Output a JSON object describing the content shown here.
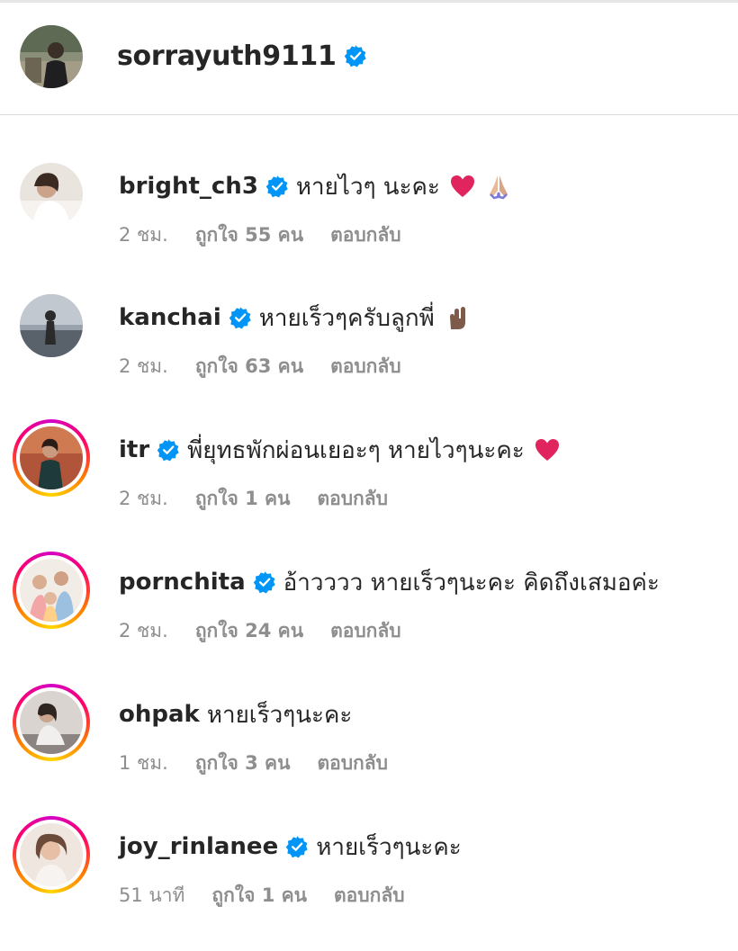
{
  "post_author": {
    "username": "sorrayuth9111",
    "verified": true,
    "avatar": "avatar-man-outdoor"
  },
  "comments": [
    {
      "username": "bright_ch3",
      "verified": true,
      "text": "หายไวๆ นะคะ",
      "emoji": [
        "red-heart-emoji",
        "folded-hands-emoji"
      ],
      "time": "2 ชม.",
      "likes": "ถูกใจ 55 คน",
      "reply": "ตอบกลับ",
      "story_ring": false
    },
    {
      "username": "kanchai",
      "verified": true,
      "text": "หายเร็วๆครับลูกพี่",
      "emoji": [
        "rock-hand-emoji"
      ],
      "time": "2 ชม.",
      "likes": "ถูกใจ 63 คน",
      "reply": "ตอบกลับ",
      "story_ring": false
    },
    {
      "username": "itr",
      "verified": true,
      "text": "พี่ยุทธพักผ่อนเยอะๆ หายไวๆนะคะ",
      "emoji": [
        "red-heart-emoji"
      ],
      "time": "2 ชม.",
      "likes": "ถูกใจ 1 คน",
      "reply": "ตอบกลับ",
      "story_ring": true
    },
    {
      "username": "pornchita",
      "verified": true,
      "text": "อ้าวววว หายเร็วๆนะคะ คิดถึงเสมอค่ะ",
      "emoji": [],
      "time": "2 ชม.",
      "likes": "ถูกใจ 24 คน",
      "reply": "ตอบกลับ",
      "story_ring": true
    },
    {
      "username": "ohpak",
      "verified": false,
      "text": "หายเร็วๆนะคะ",
      "emoji": [],
      "time": "1 ชม.",
      "likes": "ถูกใจ 3 คน",
      "reply": "ตอบกลับ",
      "story_ring": true
    },
    {
      "username": "joy_rinlanee",
      "verified": true,
      "text": "หายเร็วๆนะคะ",
      "emoji": [],
      "time": "51 นาที",
      "likes": "ถูกใจ 1 คน",
      "reply": "ตอบกลับ",
      "story_ring": true
    }
  ],
  "colors": {
    "verified_blue": "#0095f6",
    "meta_gray": "#8e8e8e",
    "text_dark": "#262626",
    "heart_red": "#e0245e"
  }
}
